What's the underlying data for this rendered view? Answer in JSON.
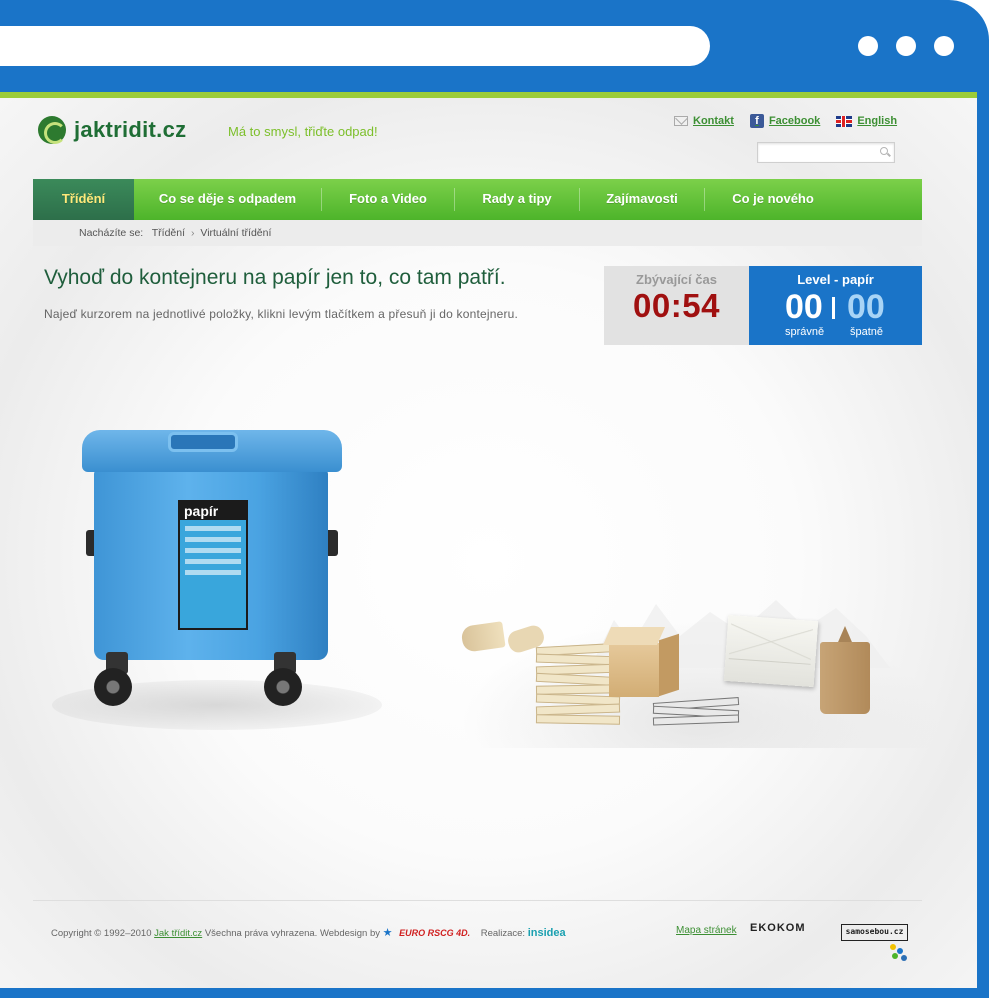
{
  "site": {
    "logo_text": "jaktridit.cz",
    "tagline": "Má to smysl, třiďte odpad!"
  },
  "toplinks": {
    "contact": "Kontakt",
    "facebook": "Facebook",
    "english": "English"
  },
  "search": {
    "placeholder": "",
    "value": ""
  },
  "nav": {
    "items": [
      {
        "label": "Třídění",
        "active": true
      },
      {
        "label": "Co se děje s odpadem"
      },
      {
        "label": "Foto a Video"
      },
      {
        "label": "Rady a tipy"
      },
      {
        "label": "Zajímavosti"
      },
      {
        "label": "Co je nového"
      }
    ]
  },
  "breadcrumb": {
    "prefix": "Nacházíte se:",
    "items": [
      "Třídění",
      "Virtuální třídění"
    ],
    "separator": "›"
  },
  "game": {
    "heading": "Vyhoď do kontejneru na papír jen to, co tam patří.",
    "instructions": "Najeď kurzorem na jednotlivé položky, klikni levým tlačítkem a přesuň ji do kontejneru.",
    "timer_label": "Zbývající čas",
    "timer_value": "00:54",
    "level_title": "Level - papír",
    "correct_value": "00",
    "wrong_value": "00",
    "correct_label": "správně",
    "wrong_label": "špatně",
    "bin_label": "papír",
    "items": [
      "paper-rolls",
      "paper-stack",
      "cardboard-box",
      "newspaper",
      "envelope",
      "paper-bag"
    ]
  },
  "footer": {
    "copyright_prefix": "Copyright © 1992–2010",
    "copyright_link": "Jak třídit.cz",
    "copyright_suffix": "Všechna práva vyhrazena. Webdesign by",
    "euro_rscg": "EURO RSCG 4D.",
    "realizace": "Realizace:",
    "insidea": "insidea",
    "sitemap": "Mapa stránek",
    "ekokom": "EKOKOM",
    "samosebou": "samosebou.cz"
  },
  "colors": {
    "frame_blue": "#1a74c8",
    "nav_green": "#4db42a",
    "active_tab": "#2d6f4a",
    "timer_red": "#a01010",
    "heading_green": "#1f5e3c"
  }
}
